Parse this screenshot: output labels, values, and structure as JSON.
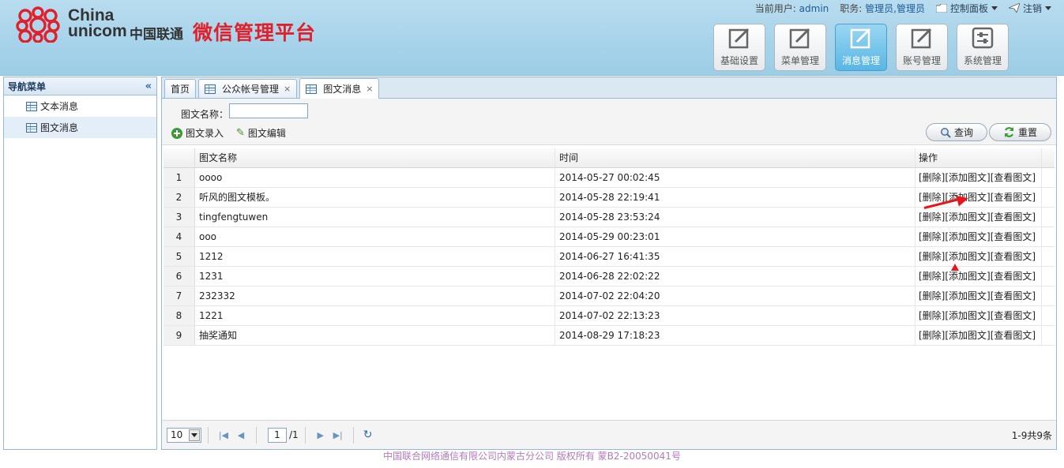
{
  "header": {
    "brand_en_line1": "China",
    "brand_en_line2": "unicom",
    "brand_cn": "中国联通",
    "platform_title": "微信管理平台",
    "user_label": "当前用户:",
    "user_value": "admin",
    "role_label": "职务:",
    "role_value": "管理员,管理员",
    "control_panel": "控制面板",
    "logout": "注销",
    "brand_color": "#e0202a"
  },
  "modules": [
    {
      "label": "基础设置",
      "active": false
    },
    {
      "label": "菜单管理",
      "active": false
    },
    {
      "label": "消息管理",
      "active": true
    },
    {
      "label": "账号管理",
      "active": false
    },
    {
      "label": "系统管理",
      "active": false
    }
  ],
  "nav": {
    "title": "导航菜单",
    "collapse_glyph": "«",
    "items": [
      {
        "label": "文本消息",
        "selected": false
      },
      {
        "label": "图文消息",
        "selected": true
      }
    ]
  },
  "tabs": [
    {
      "label": "首页",
      "active": false,
      "closable": false
    },
    {
      "label": "公众帐号管理",
      "active": false,
      "closable": true
    },
    {
      "label": "图文消息",
      "active": true,
      "closable": true
    }
  ],
  "toolbar": {
    "search_label": "图文名称：",
    "search_value": "",
    "add_label": "图文录入",
    "edit_label": "图文编辑",
    "query_label": "查询",
    "reset_label": "重置"
  },
  "grid": {
    "columns": [
      "",
      "图文名称",
      "时间",
      "操作"
    ],
    "op_delete": "[删除]",
    "op_add": "[添加图文]",
    "op_view": "[查看图文]",
    "rows": [
      {
        "num": "1",
        "name": "oooo",
        "time": "2014-05-27 00:02:45"
      },
      {
        "num": "2",
        "name": "听风的图文模板。",
        "time": "2014-05-28 22:19:41"
      },
      {
        "num": "3",
        "name": "tingfengtuwen",
        "time": "2014-05-28 23:53:24"
      },
      {
        "num": "4",
        "name": "ooo",
        "time": "2014-05-29 00:23:01"
      },
      {
        "num": "5",
        "name": "1212",
        "time": "2014-06-27 16:41:35"
      },
      {
        "num": "6",
        "name": "1231",
        "time": "2014-06-28 22:02:22"
      },
      {
        "num": "7",
        "name": "232332",
        "time": "2014-07-02 22:04:20"
      },
      {
        "num": "8",
        "name": "1221",
        "time": "2014-07-02 22:13:23"
      },
      {
        "num": "9",
        "name": "抽奖通知",
        "time": "2014-08-29 17:18:23"
      }
    ]
  },
  "pager": {
    "page_size": "10",
    "current_page": "1",
    "total_pages": "/1",
    "record_info": "1-9共9条"
  },
  "footer": {
    "text": "中国联合网络通信有限公司内蒙古分公司 版权所有 蒙B2-20050041号"
  }
}
